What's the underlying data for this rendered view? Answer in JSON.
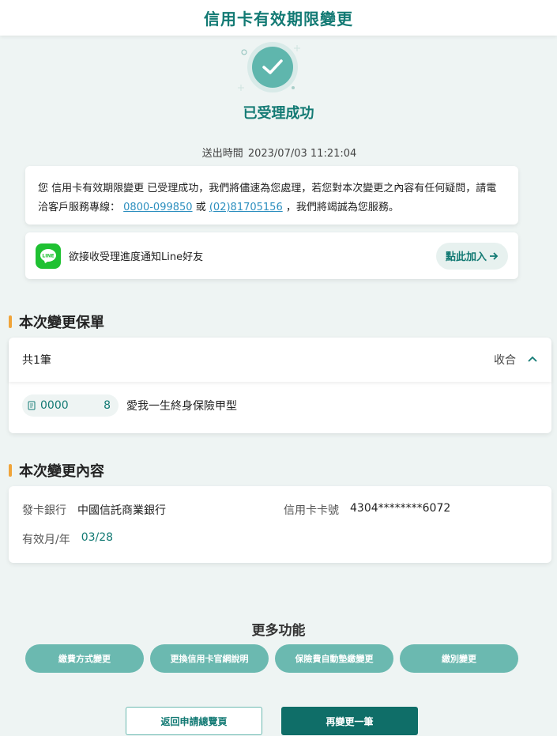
{
  "header": {
    "title": "信用卡有效期限變更"
  },
  "success": {
    "title": "已受理成功"
  },
  "submit": {
    "label": "送出時間",
    "time": "2023/07/03 11:21:04"
  },
  "notice": {
    "text_1": "您 信用卡有效期限變更 已受理成功，我們將儘速為您處理，若您對本次變更之內容有任何疑問，請電洽客戶服務專線：",
    "phone_1": "0800-099850",
    "or": "或",
    "phone_2": "(02)81705156",
    "text_2": "，我們將竭誠為您服務。"
  },
  "line": {
    "icon_text": "LINE",
    "text": "欲接收受理進度通知Line好友",
    "button": "點此加入"
  },
  "policy_section": {
    "title": "本次變更保單",
    "count": "共1筆",
    "collapse": "收合",
    "policy": {
      "number_start": "0000",
      "number_end": "8",
      "name": "愛我一生終身保險甲型"
    }
  },
  "content_section": {
    "title": "本次變更內容",
    "bank_label": "發卡銀行",
    "bank_value": "中國信託商業銀行",
    "card_label": "信用卡卡號",
    "card_value": "4304********6072",
    "expiry_label": "有效月/年",
    "expiry_value": "03/28"
  },
  "more": {
    "title": "更多功能",
    "buttons": [
      "繳費方式變更",
      "更換信用卡官網說明",
      "保險費自動墊繳變更",
      "繳別變更"
    ]
  },
  "actions": {
    "back": "返回申請總覽頁",
    "again": "再變更一筆"
  },
  "colors": {
    "primary": "#137a74",
    "accent": "#f0a43a",
    "line_green": "#1fc132",
    "button_teal": "#6bb9b0"
  }
}
